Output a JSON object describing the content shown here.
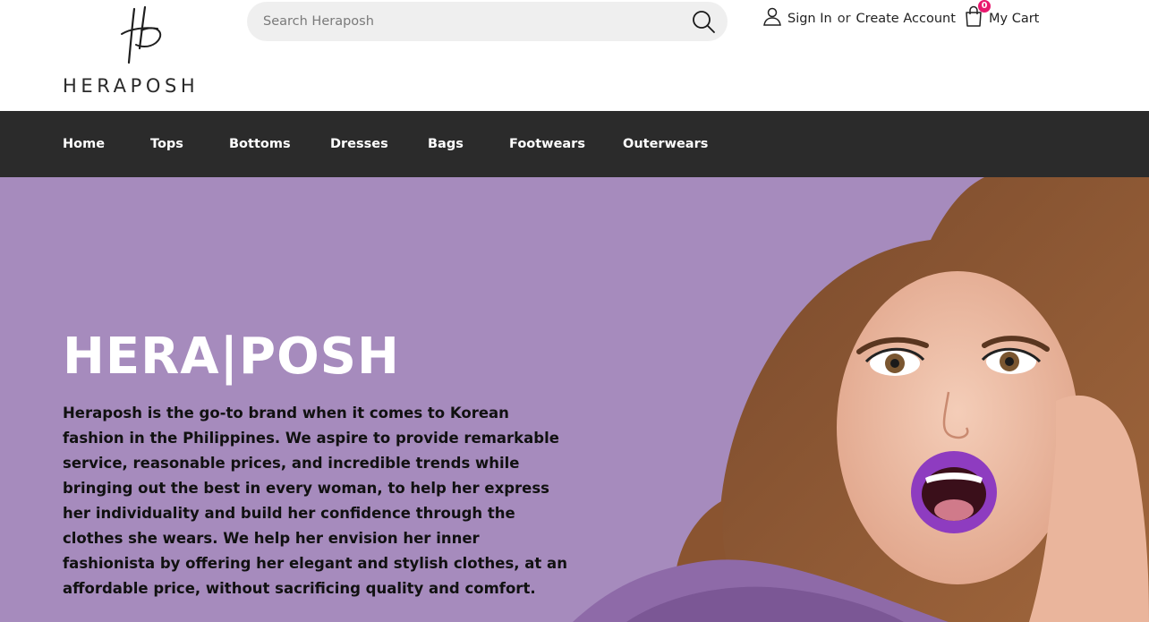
{
  "brand": {
    "wordmark": "HERAPOSH",
    "monogram": "HP"
  },
  "search": {
    "placeholder": "Search Heraposh",
    "value": ""
  },
  "account": {
    "sign_in": "Sign In",
    "separator": "or",
    "create": "Create Account"
  },
  "cart": {
    "label": "My Cart",
    "count": "0"
  },
  "nav": {
    "items": [
      {
        "label": "Home"
      },
      {
        "label": "Tops"
      },
      {
        "label": "Bottoms"
      },
      {
        "label": "Dresses"
      },
      {
        "label": "Bags"
      },
      {
        "label": "Footwears"
      },
      {
        "label": "Outerwears"
      }
    ]
  },
  "hero": {
    "title": "HERA|POSH",
    "body": "Heraposh is the go-to brand when it comes to Korean fashion in the Philippines. We aspire to provide remarkable service, reasonable prices, and incredible trends while bringing out the best in every woman, to help her express her individuality and build her confidence through the clothes she wears. We help her envision her inner fashionista by offering her elegant and stylish clothes, at an affordable price, without sacrificing quality and comfort."
  },
  "colors": {
    "nav_bg": "#2b2b2b",
    "hero_bg": "#a68bbd",
    "badge": "#e8186e",
    "search_bg": "#efefef"
  },
  "icons": {
    "search": "search-icon",
    "user": "user-icon",
    "cart": "shopping-bag-icon"
  }
}
